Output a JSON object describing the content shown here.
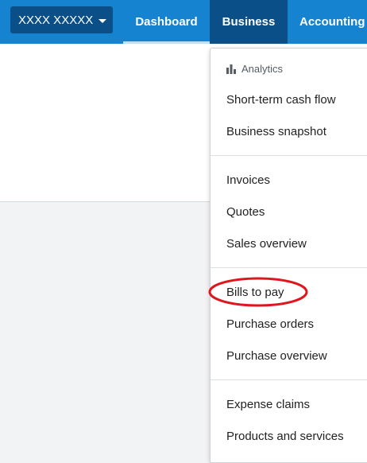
{
  "topbar": {
    "org_name": "XXXX XXXXX",
    "tabs": {
      "dashboard": "Dashboard",
      "business": "Business",
      "accounting": "Accounting"
    }
  },
  "menu": {
    "analytics_heading": "Analytics",
    "items": {
      "short_term_cash_flow": "Short-term cash flow",
      "business_snapshot": "Business snapshot",
      "invoices": "Invoices",
      "quotes": "Quotes",
      "sales_overview": "Sales overview",
      "bills_to_pay": "Bills to pay",
      "purchase_orders": "Purchase orders",
      "purchase_overview": "Purchase overview",
      "expense_claims": "Expense claims",
      "products_and_services": "Products and services"
    }
  },
  "annotation": {
    "highlight_color": "#e0161e",
    "highlighted_item": "Bills to pay"
  },
  "colors": {
    "nav_bg": "#1583cf",
    "nav_active": "#0b4f88"
  }
}
